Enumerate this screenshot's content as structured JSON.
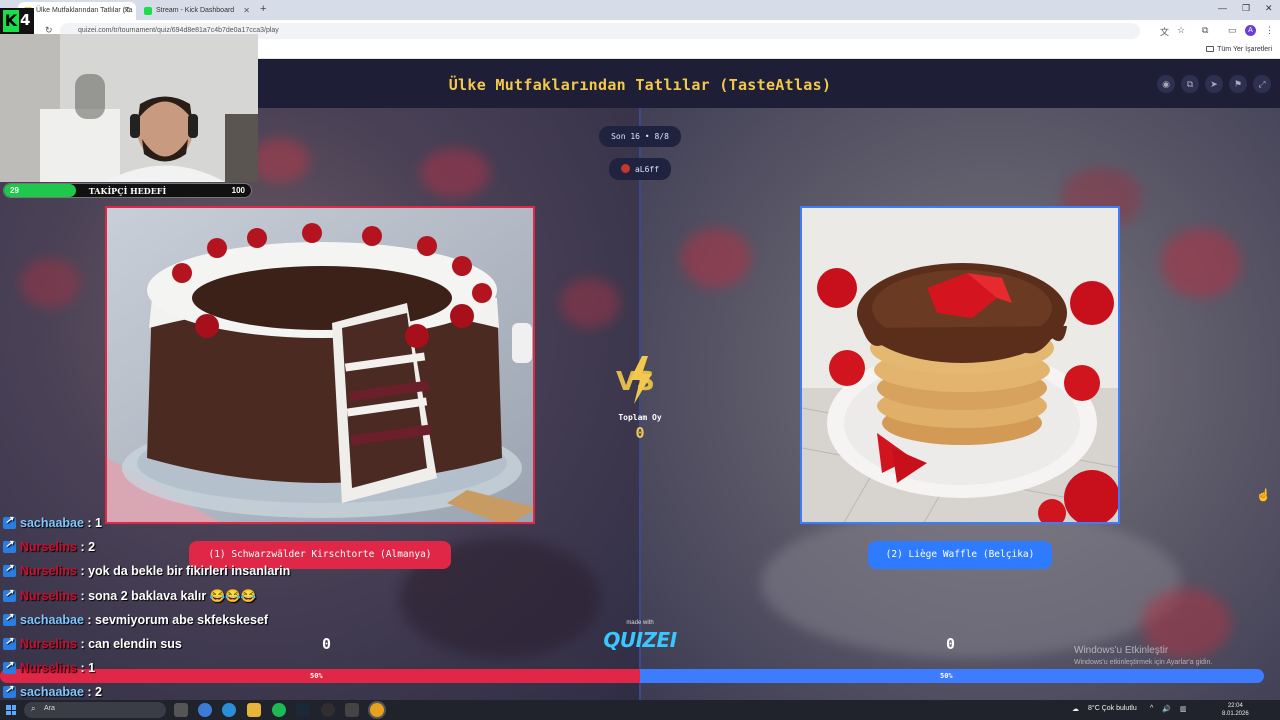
{
  "browser": {
    "tabs": [
      {
        "title": "Ülke Mutfaklarından Tatlılar (Ta",
        "active": true
      },
      {
        "title": "Stream - Kick Dashboard",
        "active": false
      }
    ],
    "url": "quizei.com/tr/tournament/quiz/694d8e81a7c4b7de0a17cca3/play",
    "bookmarks_label": "Tüm Yer İşaretleri",
    "profile_initial": "A"
  },
  "quiz": {
    "title": "Ülke Mutfaklarından Tatlılar (TasteAtlas)",
    "round": "Son 16 • 8/8",
    "username": "aL6ff",
    "total_votes_label": "Toplam Oy",
    "total_votes": "0",
    "vs_label": "VS",
    "left": {
      "label": "(1) Schwarzwälder Kirschtorte (Almanya)",
      "score": "0",
      "percent": "50%"
    },
    "right": {
      "label": "(2) Liège Waffle (Belçika)",
      "score": "0",
      "percent": "50%"
    },
    "made_with": "made with",
    "brand": "QUIZEI",
    "accent_left": "#e02747",
    "accent_right": "#3d7bff",
    "title_color": "#f2c94c"
  },
  "stream": {
    "logo_letter": "K",
    "logo_number": "4",
    "follow_goal": {
      "current": "29",
      "label": "TAKİPÇİ HEDEFİ",
      "target": "100"
    },
    "chat": [
      {
        "user": "sachaabae",
        "user_color": "blue",
        "message": " : 1"
      },
      {
        "user": "Nurselins",
        "user_color": "red",
        "message": " : 2"
      },
      {
        "user": "Nurselins",
        "user_color": "red",
        "message": " : yok da bekle bir fikirleri insanlarin"
      },
      {
        "user": "Nurselins",
        "user_color": "red",
        "message": " : sona 2 baklava kalır 😂😂😂"
      },
      {
        "user": "sachaabae",
        "user_color": "blue",
        "message": " : sevmiyorum abe skfekskesef"
      },
      {
        "user": "Nurselins",
        "user_color": "red",
        "message": " : can elendin sus"
      },
      {
        "user": "Nurselins",
        "user_color": "red",
        "message": " : 1"
      },
      {
        "user": "sachaabae",
        "user_color": "blue",
        "message": " : 2"
      }
    ]
  },
  "windows": {
    "activation_title": "Windows'u Etkinleştir",
    "activation_sub": "Windows'u etkinleştirmek için Ayarlar'a gidin.",
    "search_placeholder": "Ara",
    "weather": "8°C  Çok bulutlu",
    "time": "22:04",
    "date": "8.01.2026"
  }
}
